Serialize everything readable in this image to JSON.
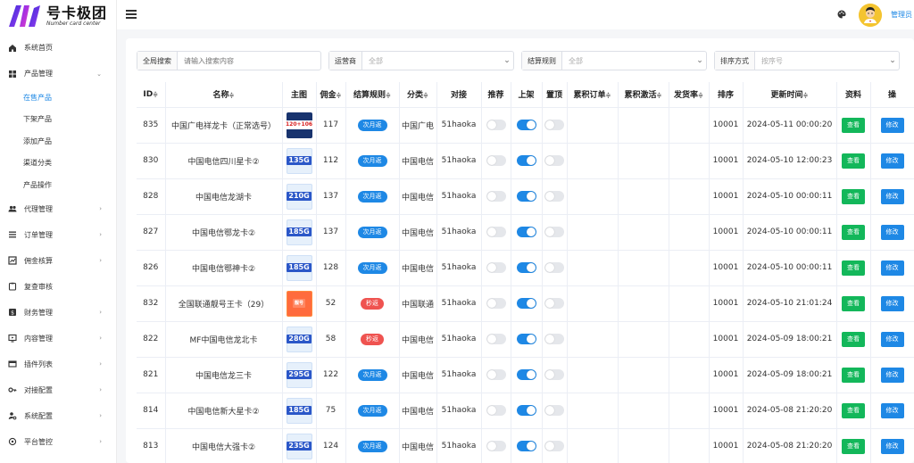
{
  "logo": {
    "title": "号卡极团",
    "subtitle": "Number card center"
  },
  "sidebar": {
    "items": [
      {
        "label": "系统首页",
        "icon": "home-icon",
        "has_arrow": false
      },
      {
        "label": "产品管理",
        "icon": "grid-icon",
        "has_arrow": true,
        "expanded": true
      },
      {
        "label": "代理管理",
        "icon": "users-icon",
        "has_arrow": true
      },
      {
        "label": "订单管理",
        "icon": "list-icon",
        "has_arrow": true
      },
      {
        "label": "佣金核算",
        "icon": "chart-icon",
        "has_arrow": true
      },
      {
        "label": "复查审核",
        "icon": "clipboard-icon",
        "has_arrow": false
      },
      {
        "label": "财务管理",
        "icon": "finance-icon",
        "has_arrow": true
      },
      {
        "label": "内容管理",
        "icon": "content-icon",
        "has_arrow": true
      },
      {
        "label": "插件列表",
        "icon": "plugin-icon",
        "has_arrow": true
      },
      {
        "label": "对接配置",
        "icon": "key-icon",
        "has_arrow": true
      },
      {
        "label": "系统配置",
        "icon": "user-gear-icon",
        "has_arrow": true
      },
      {
        "label": "平台管控",
        "icon": "control-icon",
        "has_arrow": true
      }
    ],
    "subitems": [
      "在售产品",
      "下架产品",
      "添加产品",
      "渠道分类",
      "产品操作"
    ],
    "active_subitem": "在售产品"
  },
  "header": {
    "user_name": "管理员"
  },
  "filters": {
    "search_label": "全局搜索",
    "search_placeholder": "请输入搜索内容",
    "operator_label": "运营商",
    "operator_value": "全部",
    "settlement_label": "结算规则",
    "settlement_value": "全部",
    "sort_label": "排序方式",
    "sort_value": "按序号"
  },
  "table": {
    "columns": [
      {
        "label": "ID",
        "sortable": true
      },
      {
        "label": "名称",
        "sortable": true
      },
      {
        "label": "主图",
        "sortable": false
      },
      {
        "label": "佣金",
        "sortable": true
      },
      {
        "label": "结算规则",
        "sortable": true
      },
      {
        "label": "分类",
        "sortable": true
      },
      {
        "label": "对接",
        "sortable": false
      },
      {
        "label": "推荐",
        "sortable": false
      },
      {
        "label": "上架",
        "sortable": false
      },
      {
        "label": "置顶",
        "sortable": false
      },
      {
        "label": "累积订单",
        "sortable": true
      },
      {
        "label": "累积激活",
        "sortable": true
      },
      {
        "label": "发货率",
        "sortable": true
      },
      {
        "label": "排序",
        "sortable": false
      },
      {
        "label": "更新时间",
        "sortable": true
      },
      {
        "label": "资料",
        "sortable": false
      },
      {
        "label": "操",
        "sortable": false
      }
    ],
    "view_label": "查看",
    "edit_label": "修改",
    "rows": [
      {
        "id": "835",
        "name": "中国广电祥龙卡（正常选号）",
        "thumb": "120+106",
        "thumb_style": "dark",
        "commission": "117",
        "rule": "次月返",
        "rule_color": "blue",
        "category": "中国广电",
        "dock": "51haoka",
        "recommend": false,
        "listed": true,
        "pinned": false,
        "sort": "10001",
        "updated": "2024-05-11 00:00:20"
      },
      {
        "id": "830",
        "name": "中国电信四川星卡②",
        "thumb": "135G",
        "thumb_style": "blue",
        "commission": "112",
        "rule": "次月返",
        "rule_color": "blue",
        "category": "中国电信",
        "dock": "51haoka",
        "recommend": false,
        "listed": true,
        "pinned": false,
        "sort": "10001",
        "updated": "2024-05-10 12:00:23"
      },
      {
        "id": "828",
        "name": "中国电信龙湖卡",
        "thumb": "210G",
        "thumb_style": "blue",
        "commission": "137",
        "rule": "次月返",
        "rule_color": "blue",
        "category": "中国电信",
        "dock": "51haoka",
        "recommend": false,
        "listed": true,
        "pinned": false,
        "sort": "10001",
        "updated": "2024-05-10 00:00:11"
      },
      {
        "id": "827",
        "name": "中国电信鄂龙卡②",
        "thumb": "185G",
        "thumb_style": "blue",
        "commission": "137",
        "rule": "次月返",
        "rule_color": "blue",
        "category": "中国电信",
        "dock": "51haoka",
        "recommend": false,
        "listed": true,
        "pinned": false,
        "sort": "10001",
        "updated": "2024-05-10 00:00:11"
      },
      {
        "id": "826",
        "name": "中国电信鄂神卡②",
        "thumb": "185G",
        "thumb_style": "blue",
        "commission": "128",
        "rule": "次月返",
        "rule_color": "blue",
        "category": "中国电信",
        "dock": "51haoka",
        "recommend": false,
        "listed": true,
        "pinned": false,
        "sort": "10001",
        "updated": "2024-05-10 00:00:11"
      },
      {
        "id": "832",
        "name": "全国联通靓号王卡（29）",
        "thumb": "靓号",
        "thumb_style": "red",
        "commission": "52",
        "rule": "秒返",
        "rule_color": "red",
        "category": "中国联通",
        "dock": "51haoka",
        "recommend": false,
        "listed": true,
        "pinned": false,
        "sort": "10001",
        "updated": "2024-05-10 21:01:24"
      },
      {
        "id": "822",
        "name": "MF中国电信龙北卡",
        "thumb": "280G",
        "thumb_style": "blue",
        "commission": "58",
        "rule": "秒返",
        "rule_color": "red",
        "category": "中国电信",
        "dock": "51haoka",
        "recommend": false,
        "listed": true,
        "pinned": false,
        "sort": "10001",
        "updated": "2024-05-09 18:00:21"
      },
      {
        "id": "821",
        "name": "中国电信龙三卡",
        "thumb": "295G",
        "thumb_style": "blue",
        "commission": "122",
        "rule": "次月返",
        "rule_color": "blue",
        "category": "中国电信",
        "dock": "51haoka",
        "recommend": false,
        "listed": true,
        "pinned": false,
        "sort": "10001",
        "updated": "2024-05-09 18:00:21"
      },
      {
        "id": "814",
        "name": "中国电信新大星卡②",
        "thumb": "185G",
        "thumb_style": "blue",
        "commission": "75",
        "rule": "次月返",
        "rule_color": "blue",
        "category": "中国电信",
        "dock": "51haoka",
        "recommend": false,
        "listed": true,
        "pinned": false,
        "sort": "10001",
        "updated": "2024-05-08 21:20:20"
      },
      {
        "id": "813",
        "name": "中国电信大强卡②",
        "thumb": "235G",
        "thumb_style": "blue",
        "commission": "124",
        "rule": "次月返",
        "rule_color": "blue",
        "category": "中国电信",
        "dock": "51haoka",
        "recommend": false,
        "listed": true,
        "pinned": false,
        "sort": "10001",
        "updated": "2024-05-08 21:20:20"
      }
    ]
  }
}
